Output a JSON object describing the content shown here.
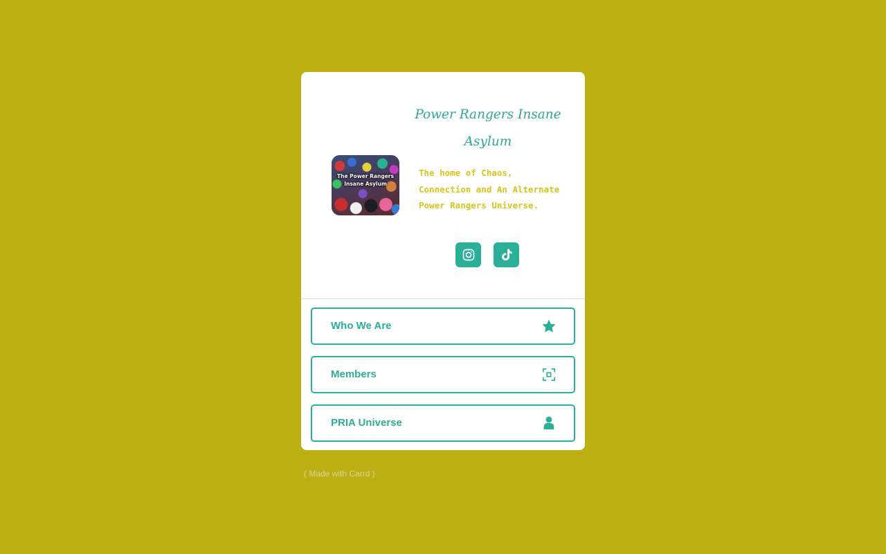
{
  "site": {
    "title": "Power Rangers Insane Asylum",
    "tagline": "The home of Chaos, Connection and An Alternate Power Rangers Universe.",
    "logo_text": "The Power Rangers Insane Asylum"
  },
  "socials": [
    {
      "name": "instagram",
      "icon": "instagram-icon"
    },
    {
      "name": "tiktok",
      "icon": "tiktok-icon"
    }
  ],
  "links": [
    {
      "label": "Who We Are",
      "icon": "star-icon"
    },
    {
      "label": "Members",
      "icon": "focus-frame-icon"
    },
    {
      "label": "PRIA Universe",
      "icon": "user-icon"
    }
  ],
  "footer": {
    "made_with": "( Made with Carrd )"
  },
  "colors": {
    "background": "#bdae14",
    "accent": "#2aaf98",
    "tagline": "#d6c51b",
    "card": "#ffffff"
  }
}
